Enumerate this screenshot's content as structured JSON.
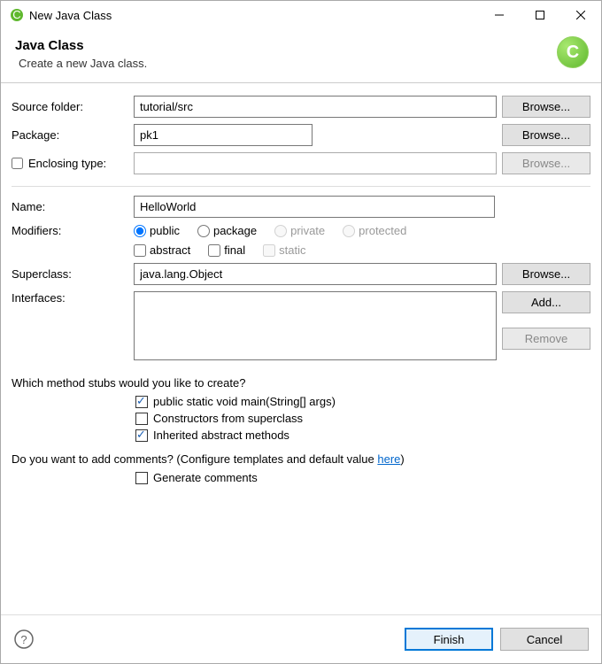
{
  "window": {
    "title": "New Java Class"
  },
  "header": {
    "title": "Java Class",
    "subtitle": "Create a new Java class.",
    "badge": "C"
  },
  "labels": {
    "sourceFolder": "Source folder:",
    "package": "Package:",
    "enclosingType": "Enclosing type:",
    "name": "Name:",
    "modifiers": "Modifiers:",
    "superclass": "Superclass:",
    "interfaces": "Interfaces:"
  },
  "fields": {
    "sourceFolder": "tutorial/src",
    "package": "pk1",
    "enclosingType": "",
    "name": "HelloWorld",
    "superclass": "java.lang.Object"
  },
  "buttons": {
    "browse": "Browse...",
    "add": "Add...",
    "remove": "Remove",
    "finish": "Finish",
    "cancel": "Cancel"
  },
  "modifiers": {
    "access": {
      "public": "public",
      "package": "package",
      "private": "private",
      "protected": "protected"
    },
    "other": {
      "abstract": "abstract",
      "final": "final",
      "static": "static"
    }
  },
  "stubs": {
    "question": "Which method stubs would you like to create?",
    "main": "public static void main(String[] args)",
    "ctors": "Constructors from superclass",
    "inherited": "Inherited abstract methods"
  },
  "comments": {
    "question_pre": "Do you want to add comments? (Configure templates and default value ",
    "link": "here",
    "question_post": ")",
    "generate": "Generate comments"
  }
}
